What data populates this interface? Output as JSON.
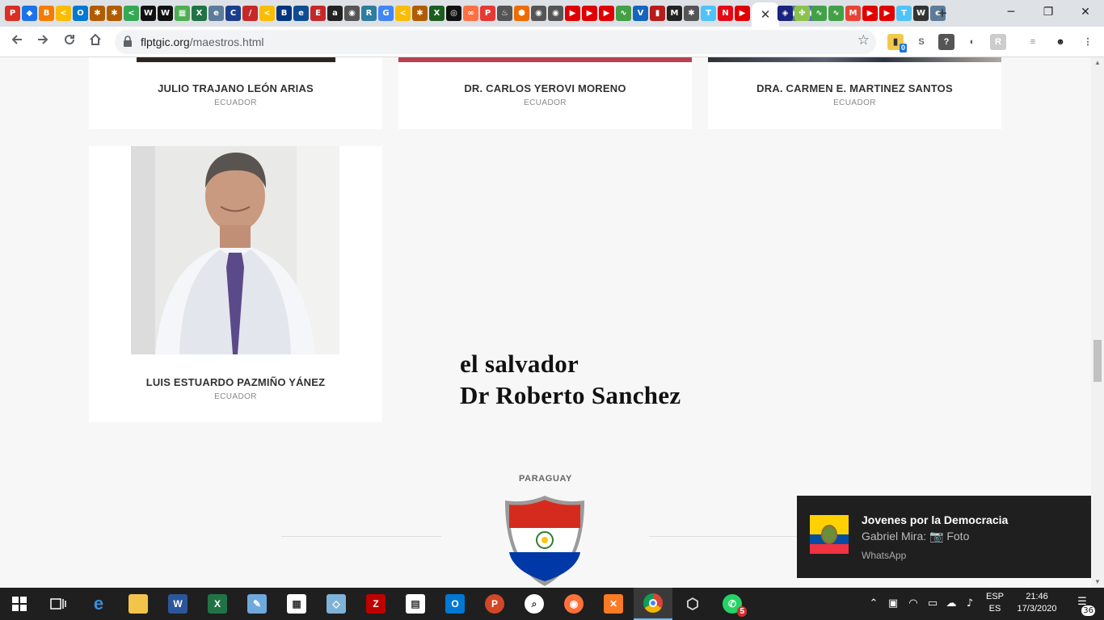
{
  "browser": {
    "tab_icons": [
      {
        "icon": "pdf-icon",
        "color": "#d93025",
        "glyph": "P"
      },
      {
        "icon": "extension-icon",
        "color": "#1a73e8",
        "glyph": "◆"
      },
      {
        "icon": "blogger-icon",
        "color": "#f57c00",
        "glyph": "B"
      },
      {
        "icon": "bracket-icon",
        "color": "#fbbc04",
        "glyph": "<"
      },
      {
        "icon": "outlook-icon",
        "color": "#0078d4",
        "glyph": "O"
      },
      {
        "icon": "bug-icon",
        "color": "#b15c00",
        "glyph": "✱"
      },
      {
        "icon": "bug-icon",
        "color": "#b15c00",
        "glyph": "✱"
      },
      {
        "icon": "bracket-icon",
        "color": "#34a853",
        "glyph": "<"
      },
      {
        "icon": "w-icon",
        "color": "#111111",
        "glyph": "W"
      },
      {
        "icon": "w-icon",
        "color": "#111111",
        "glyph": "W"
      },
      {
        "icon": "grid-icon",
        "color": "#4caf50",
        "glyph": "▦"
      },
      {
        "icon": "excel-icon",
        "color": "#217346",
        "glyph": "X"
      },
      {
        "icon": "edu-icon",
        "color": "#5c7c99",
        "glyph": "e"
      },
      {
        "icon": "c-icon",
        "color": "#1a3e8c",
        "glyph": "C"
      },
      {
        "icon": "tools-icon",
        "color": "#c62828",
        "glyph": "/"
      },
      {
        "icon": "bracket-icon",
        "color": "#fbbc04",
        "glyph": "<"
      },
      {
        "icon": "booking-icon",
        "color": "#003580",
        "glyph": "B"
      },
      {
        "icon": "edge-icon",
        "color": "#0e4d92",
        "glyph": "e"
      },
      {
        "icon": "e-icon",
        "color": "#c62828",
        "glyph": "E"
      },
      {
        "icon": "amazon-icon",
        "color": "#222222",
        "glyph": "a"
      },
      {
        "icon": "globe-icon",
        "color": "#555555",
        "glyph": "◉"
      },
      {
        "icon": "r-icon",
        "color": "#2e7d9e",
        "glyph": "R"
      },
      {
        "icon": "g-icon",
        "color": "#4285f4",
        "glyph": "G"
      },
      {
        "icon": "bracket-icon",
        "color": "#fbbc04",
        "glyph": "<"
      },
      {
        "icon": "bug-icon",
        "color": "#b15c00",
        "glyph": "✱"
      },
      {
        "icon": "x-icon",
        "color": "#1b5e20",
        "glyph": "X"
      },
      {
        "icon": "ring-icon",
        "color": "#111111",
        "glyph": "◎"
      },
      {
        "icon": "link-icon",
        "color": "#ff7043",
        "glyph": "∞"
      },
      {
        "icon": "pin-icon",
        "color": "#e53935",
        "glyph": "P"
      },
      {
        "icon": "cup-icon",
        "color": "#555555",
        "glyph": "♨"
      },
      {
        "icon": "hex-icon",
        "color": "#ef6c00",
        "glyph": "⬢"
      },
      {
        "icon": "globe-icon",
        "color": "#555555",
        "glyph": "◉"
      },
      {
        "icon": "globe-icon",
        "color": "#555555",
        "glyph": "◉"
      },
      {
        "icon": "youtube-icon",
        "color": "#e00000",
        "glyph": "▶"
      },
      {
        "icon": "youtube-icon",
        "color": "#e00000",
        "glyph": "▶"
      },
      {
        "icon": "youtube-icon",
        "color": "#e00000",
        "glyph": "▶"
      },
      {
        "icon": "chart-icon",
        "color": "#43a047",
        "glyph": "∿"
      },
      {
        "icon": "v-icon",
        "color": "#1565c0",
        "glyph": "V"
      },
      {
        "icon": "book-icon",
        "color": "#b71c1c",
        "glyph": "▮"
      },
      {
        "icon": "m-icon",
        "color": "#222222",
        "glyph": "M"
      },
      {
        "icon": "bug-icon",
        "color": "#555555",
        "glyph": "✱"
      },
      {
        "icon": "t-icon",
        "color": "#4fc3f7",
        "glyph": "T"
      },
      {
        "icon": "n-icon",
        "color": "#e50914",
        "glyph": "N"
      },
      {
        "icon": "youtube-icon",
        "color": "#e00000",
        "glyph": "▶"
      },
      {
        "icon": "t-icon",
        "color": "#4fc3f7",
        "glyph": "T"
      },
      {
        "icon": "g-icon",
        "color": "#4285f4",
        "glyph": "G"
      },
      {
        "icon": "box-icon",
        "color": "#607d8b",
        "glyph": "▣"
      },
      {
        "icon": "globe-icon",
        "color": "#5c6bc0",
        "glyph": "◉"
      }
    ],
    "tab_icons_right": [
      {
        "icon": "shield-icon",
        "color": "#1a237e",
        "glyph": "◈"
      },
      {
        "icon": "pinwheel-icon",
        "color": "#8bc34a",
        "glyph": "✤"
      },
      {
        "icon": "chart-icon",
        "color": "#43a047",
        "glyph": "∿"
      },
      {
        "icon": "chart-icon",
        "color": "#43a047",
        "glyph": "∿"
      },
      {
        "icon": "gmail-icon",
        "color": "#ea4335",
        "glyph": "M"
      },
      {
        "icon": "youtube-icon",
        "color": "#e00000",
        "glyph": "▶"
      },
      {
        "icon": "youtube-icon",
        "color": "#e00000",
        "glyph": "▶"
      },
      {
        "icon": "t-icon",
        "color": "#4fc3f7",
        "glyph": "T"
      },
      {
        "icon": "wikipedia-icon",
        "color": "#333333",
        "glyph": "W"
      },
      {
        "icon": "edu-icon",
        "color": "#5c7c99",
        "glyph": "e"
      }
    ],
    "active_tab_close": "✕",
    "new_tab": "+",
    "url_host": "flptgic.org",
    "url_path": "/maestros.html",
    "extension_badge": "0"
  },
  "page": {
    "cards_top_row": [
      {
        "name": "JULIO TRAJANO LEÓN ARIAS",
        "country": "ECUADOR"
      },
      {
        "name": "DR. CARLOS YEROVI MORENO",
        "country": "ECUADOR"
      },
      {
        "name": "DRA. CARMEN E. MARTINEZ SANTOS",
        "country": "ECUADOR"
      }
    ],
    "card_featured": {
      "name": "LUIS ESTUARDO PAZMIÑO YÁNEZ",
      "country": "ECUADOR"
    },
    "announcement_line1": "el salvador",
    "announcement_line2": "Dr Roberto Sanchez",
    "section_title": "PARAGUAY"
  },
  "toast": {
    "title": "Jovenes por la Democracia",
    "body": "Gabriel Mira: 📷 Foto",
    "app": "WhatsApp"
  },
  "taskbar": {
    "lang_top": "ESP",
    "lang_bottom": "ES",
    "time": "21:46",
    "date": "17/3/2020",
    "notification_count": "36",
    "whatsapp_badge": "5"
  }
}
